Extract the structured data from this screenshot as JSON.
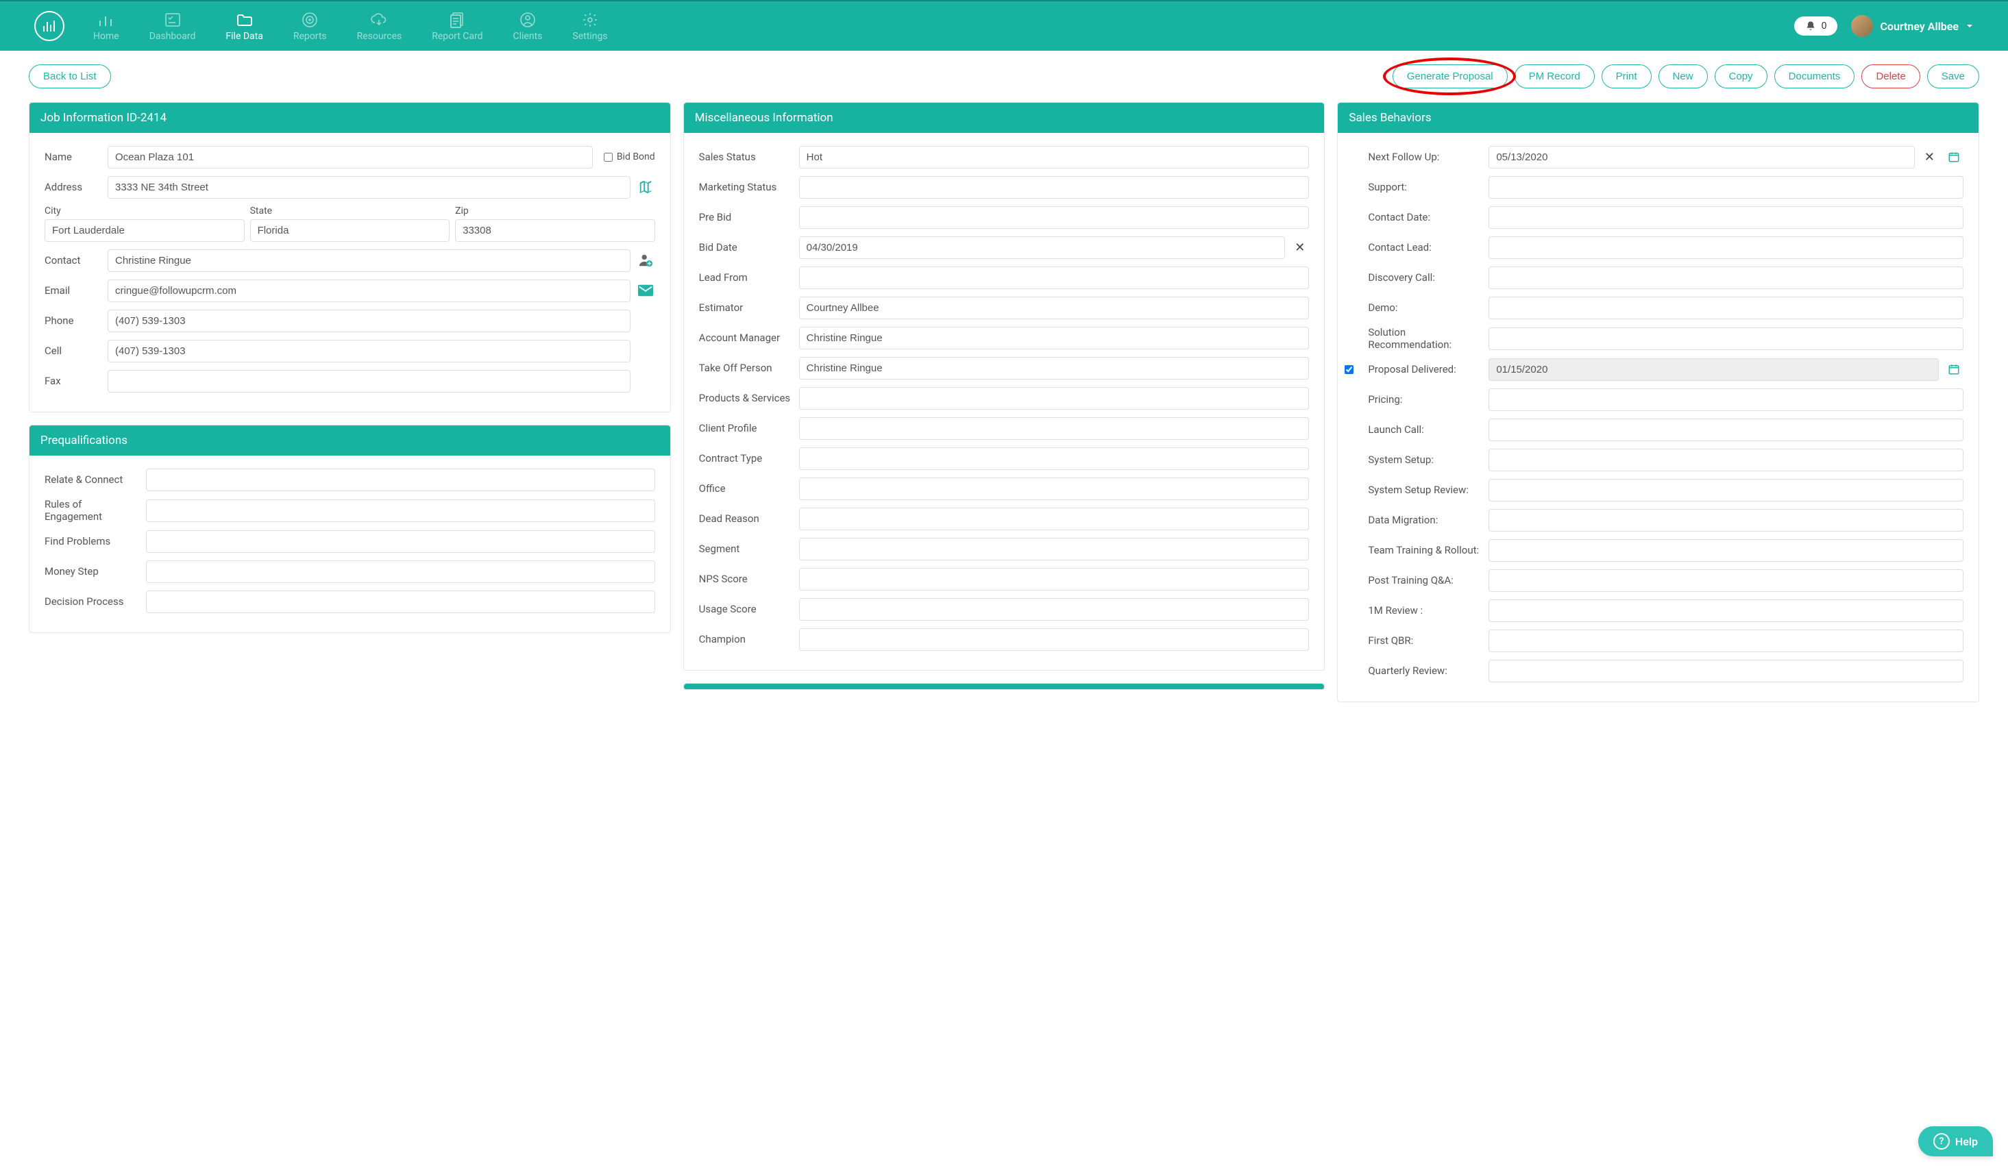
{
  "nav": {
    "items": [
      {
        "label": "Home"
      },
      {
        "label": "Dashboard"
      },
      {
        "label": "File Data"
      },
      {
        "label": "Reports"
      },
      {
        "label": "Resources"
      },
      {
        "label": "Report Card"
      },
      {
        "label": "Clients"
      },
      {
        "label": "Settings"
      }
    ],
    "notifications": "0",
    "user_name": "Courtney Allbee"
  },
  "actions": {
    "back": "Back to List",
    "generate": "Generate Proposal",
    "pm": "PM Record",
    "print": "Print",
    "new": "New",
    "copy": "Copy",
    "documents": "Documents",
    "delete": "Delete",
    "save": "Save"
  },
  "job": {
    "header": "Job Information ID-2414",
    "name_lbl": "Name",
    "name": "Ocean Plaza 101",
    "bidbond_lbl": "Bid Bond",
    "address_lbl": "Address",
    "address": "3333 NE 34th Street",
    "city_lbl": "City",
    "city": "Fort Lauderdale",
    "state_lbl": "State",
    "state": "Florida",
    "zip_lbl": "Zip",
    "zip": "33308",
    "contact_lbl": "Contact",
    "contact": "Christine Ringue",
    "email_lbl": "Email",
    "email": "cringue@followupcrm.com",
    "phone_lbl": "Phone",
    "phone": "(407) 539-1303",
    "cell_lbl": "Cell",
    "cell": "(407) 539-1303",
    "fax_lbl": "Fax",
    "fax": ""
  },
  "preq": {
    "header": "Prequalifications",
    "r1": "Relate & Connect",
    "r2": "Rules of Engagement",
    "r3": "Find Problems",
    "r4": "Money Step",
    "r5": "Decision Process"
  },
  "misc": {
    "header": "Miscellaneous Information",
    "sales_status_lbl": "Sales Status",
    "sales_status": "Hot",
    "marketing_lbl": "Marketing Status",
    "prebid_lbl": "Pre Bid",
    "biddate_lbl": "Bid Date",
    "biddate": "04/30/2019",
    "leadfrom_lbl": "Lead From",
    "estimator_lbl": "Estimator",
    "estimator": "Courtney Allbee",
    "acctmgr_lbl": "Account Manager",
    "acctmgr": "Christine Ringue",
    "takeoff_lbl": "Take Off Person",
    "takeoff": "Christine Ringue",
    "products_lbl": "Products & Services",
    "clientprofile_lbl": "Client Profile",
    "contracttype_lbl": "Contract Type",
    "office_lbl": "Office",
    "deadreason_lbl": "Dead Reason",
    "segment_lbl": "Segment",
    "nps_lbl": "NPS Score",
    "usage_lbl": "Usage Score",
    "champion_lbl": "Champion"
  },
  "sales": {
    "header": "Sales Behaviors",
    "nextfollow_lbl": "Next Follow Up:",
    "nextfollow": "05/13/2020",
    "support_lbl": "Support:",
    "contactdate_lbl": "Contact Date:",
    "contactlead_lbl": "Contact Lead:",
    "discovery_lbl": "Discovery Call:",
    "demo_lbl": "Demo:",
    "solution_lbl": "Solution Recommendation:",
    "proposal_lbl": "Proposal Delivered:",
    "proposal": "01/15/2020",
    "pricing_lbl": "Pricing:",
    "launch_lbl": "Launch Call:",
    "systemsetup_lbl": "System Setup:",
    "systemreview_lbl": "System Setup Review:",
    "datamig_lbl": "Data Migration:",
    "training_lbl": "Team Training & Rollout:",
    "postqa_lbl": "Post Training Q&A:",
    "m1review_lbl": "1M Review :",
    "firstqbr_lbl": "First QBR:",
    "quarterly_lbl": "Quarterly Review:"
  },
  "help": "Help"
}
